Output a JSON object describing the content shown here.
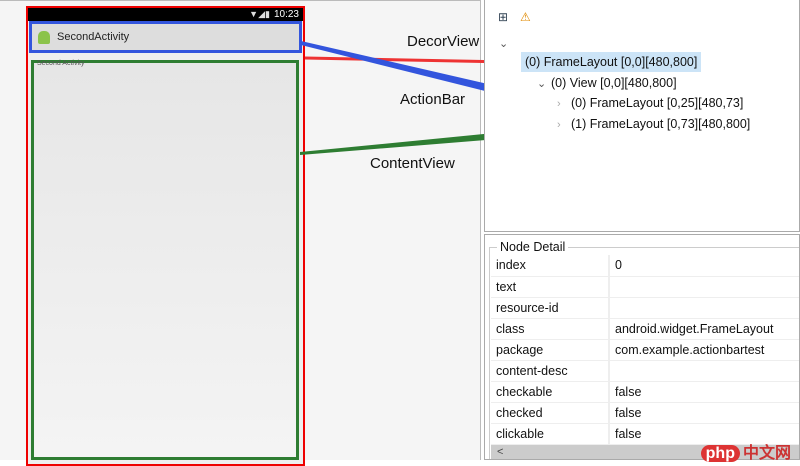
{
  "device": {
    "time": "10:23",
    "status_icons": [
      "wifi-icon",
      "signal-icon",
      "battery-icon"
    ],
    "action_bar_title": "SecondActivity",
    "content_text": "Second Activity"
  },
  "annotations": {
    "decor": "DecorView",
    "actionbar": "ActionBar",
    "content": "ContentView",
    "colors": {
      "decor": "#ee2222",
      "actionbar": "#3355dd",
      "content": "#2e7d32"
    }
  },
  "tree": [
    {
      "label": "(0) FrameLayout [0,0][480,800]",
      "selected": true
    },
    {
      "label": "(0) View [0,0][480,800]"
    },
    {
      "label": "(0) FrameLayout [0,25][480,73]"
    },
    {
      "label": "(1) FrameLayout [0,73][480,800]"
    }
  ],
  "detail": {
    "title": "Node Detail",
    "rows": [
      {
        "k": "index",
        "v": "0"
      },
      {
        "k": "text",
        "v": ""
      },
      {
        "k": "resource-id",
        "v": ""
      },
      {
        "k": "class",
        "v": "android.widget.FrameLayout"
      },
      {
        "k": "package",
        "v": "com.example.actionbartest"
      },
      {
        "k": "content-desc",
        "v": ""
      },
      {
        "k": "checkable",
        "v": "false"
      },
      {
        "k": "checked",
        "v": "false"
      },
      {
        "k": "clickable",
        "v": "false"
      }
    ]
  },
  "watermark": {
    "badge": "php",
    "text": "中文网"
  }
}
